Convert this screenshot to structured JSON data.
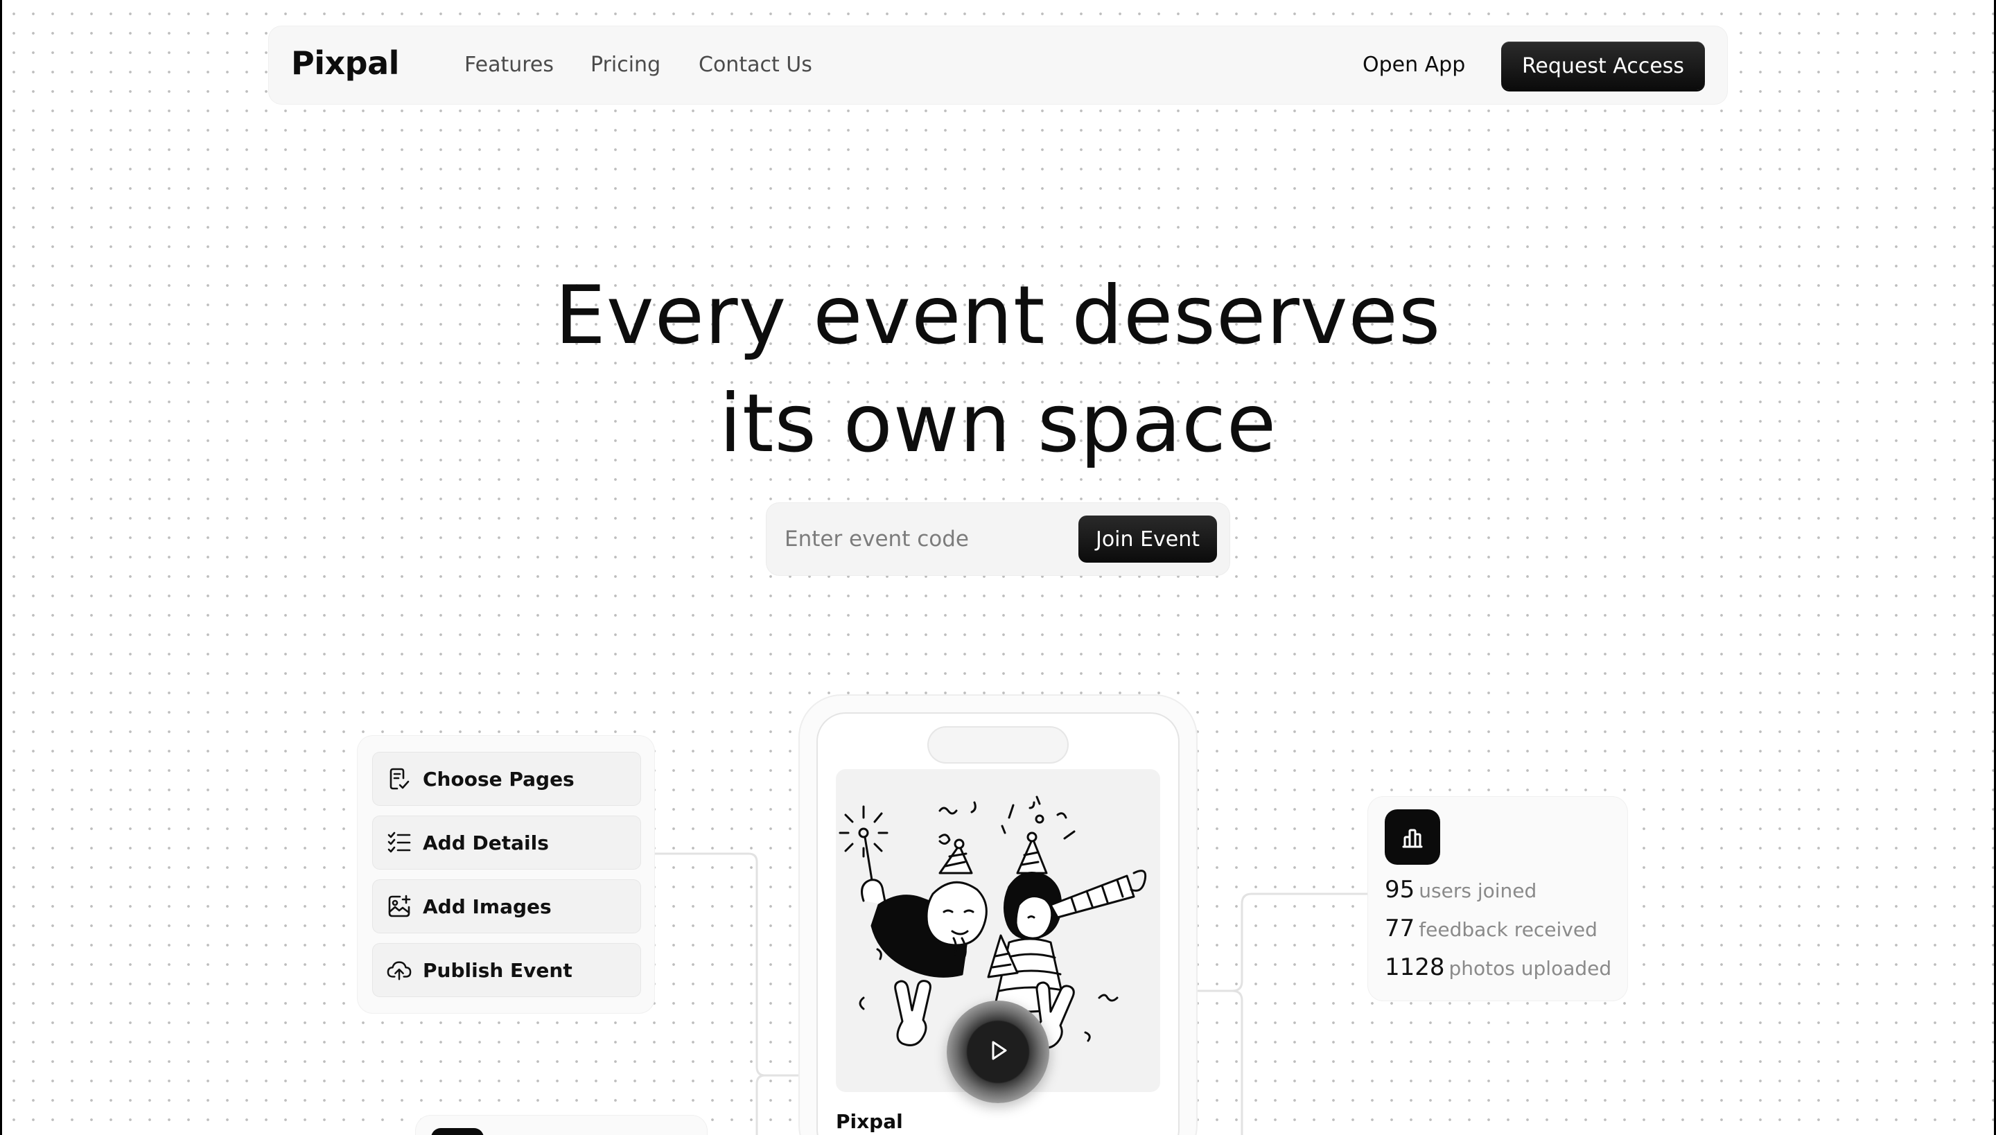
{
  "navbar": {
    "brand": "Pixpal",
    "links": [
      "Features",
      "Pricing",
      "Contact Us"
    ],
    "open_app": "Open App",
    "cta": "Request Access"
  },
  "hero": {
    "title_line1": "Every event deserves",
    "title_line2": "its own space",
    "input_placeholder": "Enter event code",
    "join_button": "Join Event"
  },
  "steps": [
    {
      "label": "Choose Pages",
      "icon": "document-check-icon"
    },
    {
      "label": "Add Details",
      "icon": "list-check-icon"
    },
    {
      "label": "Add Images",
      "icon": "image-add-icon"
    },
    {
      "label": "Publish Event",
      "icon": "cloud-upload-icon"
    }
  ],
  "phone": {
    "caption": "Pixpal",
    "illustration": "party-celebration-illustration",
    "play_icon": "play-icon"
  },
  "stats": {
    "icon": "bar-chart-icon",
    "rows": [
      {
        "value": "95",
        "label": "users joined"
      },
      {
        "value": "77",
        "label": "feedback received"
      },
      {
        "value": "1128",
        "label": "photos uploaded"
      }
    ]
  },
  "colors": {
    "accent": "#0b0b0b",
    "background": "#ffffff",
    "dot": "#bdbdbd",
    "muted_text": "#8a8a8a"
  }
}
